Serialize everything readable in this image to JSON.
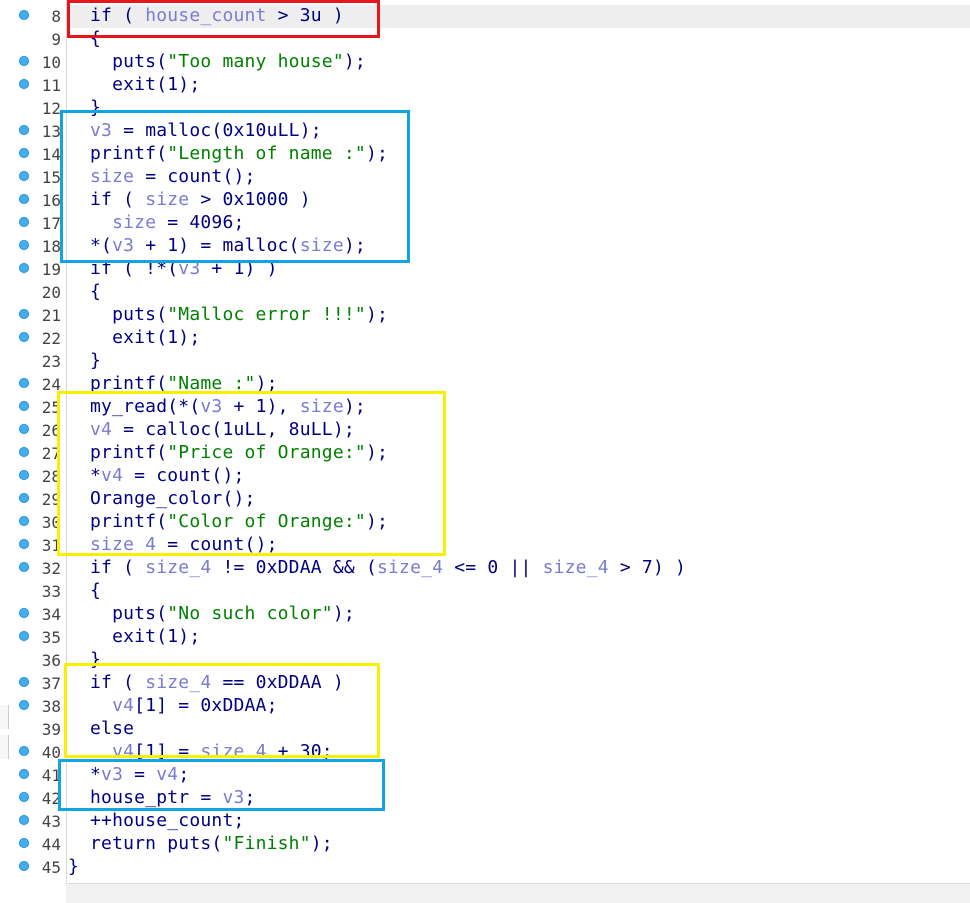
{
  "editor": {
    "lines": [
      {
        "n": "8",
        "dot": true,
        "hl": true,
        "t": [
          [
            "k",
            "if ( "
          ],
          [
            "v",
            "house_count"
          ],
          [
            "k",
            " > 3u )"
          ]
        ]
      },
      {
        "n": "9",
        "dot": false,
        "t": [
          [
            "k",
            "{"
          ]
        ]
      },
      {
        "n": "10",
        "dot": true,
        "t": [
          [
            "k",
            "  puts("
          ],
          [
            "s",
            "\"Too many house\""
          ],
          [
            "k",
            ");"
          ]
        ]
      },
      {
        "n": "11",
        "dot": true,
        "t": [
          [
            "k",
            "  exit(1);"
          ]
        ]
      },
      {
        "n": "12",
        "dot": false,
        "t": [
          [
            "k",
            "}"
          ]
        ]
      },
      {
        "n": "13",
        "dot": true,
        "t": [
          [
            "v",
            "v3"
          ],
          [
            "k",
            " = malloc(0x10uLL);"
          ]
        ]
      },
      {
        "n": "14",
        "dot": true,
        "t": [
          [
            "k",
            "printf("
          ],
          [
            "s",
            "\"Length of name :\""
          ],
          [
            "k",
            ");"
          ]
        ]
      },
      {
        "n": "15",
        "dot": true,
        "t": [
          [
            "v",
            "size"
          ],
          [
            "k",
            " = count();"
          ]
        ]
      },
      {
        "n": "16",
        "dot": true,
        "t": [
          [
            "k",
            "if ( "
          ],
          [
            "v",
            "size"
          ],
          [
            "k",
            " > 0x1000 )"
          ]
        ]
      },
      {
        "n": "17",
        "dot": true,
        "t": [
          [
            "k",
            "  "
          ],
          [
            "v",
            "size"
          ],
          [
            "k",
            " = 4096;"
          ]
        ]
      },
      {
        "n": "18",
        "dot": true,
        "t": [
          [
            "k",
            "*("
          ],
          [
            "v",
            "v3"
          ],
          [
            "k",
            " + 1) = malloc("
          ],
          [
            "v",
            "size"
          ],
          [
            "k",
            ");"
          ]
        ]
      },
      {
        "n": "19",
        "dot": true,
        "t": [
          [
            "k",
            "if ( !*("
          ],
          [
            "v",
            "v3"
          ],
          [
            "k",
            " + 1) )"
          ]
        ]
      },
      {
        "n": "20",
        "dot": false,
        "t": [
          [
            "k",
            "{"
          ]
        ]
      },
      {
        "n": "21",
        "dot": true,
        "t": [
          [
            "k",
            "  puts("
          ],
          [
            "s",
            "\"Malloc error !!!\""
          ],
          [
            "k",
            ");"
          ]
        ]
      },
      {
        "n": "22",
        "dot": true,
        "t": [
          [
            "k",
            "  exit(1);"
          ]
        ]
      },
      {
        "n": "23",
        "dot": false,
        "t": [
          [
            "k",
            "}"
          ]
        ]
      },
      {
        "n": "24",
        "dot": true,
        "t": [
          [
            "k",
            "printf("
          ],
          [
            "s",
            "\"Name :\""
          ],
          [
            "k",
            ");"
          ]
        ]
      },
      {
        "n": "25",
        "dot": true,
        "t": [
          [
            "k",
            "my_read(*("
          ],
          [
            "v",
            "v3"
          ],
          [
            "k",
            " + 1), "
          ],
          [
            "v",
            "size"
          ],
          [
            "k",
            ");"
          ]
        ]
      },
      {
        "n": "26",
        "dot": true,
        "t": [
          [
            "v",
            "v4"
          ],
          [
            "k",
            " = calloc(1uLL, 8uLL);"
          ]
        ]
      },
      {
        "n": "27",
        "dot": true,
        "t": [
          [
            "k",
            "printf("
          ],
          [
            "s",
            "\"Price of Orange:\""
          ],
          [
            "k",
            ");"
          ]
        ]
      },
      {
        "n": "28",
        "dot": true,
        "t": [
          [
            "k",
            "*"
          ],
          [
            "v",
            "v4"
          ],
          [
            "k",
            " = count();"
          ]
        ]
      },
      {
        "n": "29",
        "dot": true,
        "t": [
          [
            "k",
            "Orange_color();"
          ]
        ]
      },
      {
        "n": "30",
        "dot": true,
        "t": [
          [
            "k",
            "printf("
          ],
          [
            "s",
            "\"Color of Orange:\""
          ],
          [
            "k",
            ");"
          ]
        ]
      },
      {
        "n": "31",
        "dot": true,
        "t": [
          [
            "v",
            "size_4"
          ],
          [
            "k",
            " = count();"
          ]
        ]
      },
      {
        "n": "32",
        "dot": true,
        "t": [
          [
            "k",
            "if ( "
          ],
          [
            "v",
            "size_4"
          ],
          [
            "k",
            " != 0xDDAA && ("
          ],
          [
            "v",
            "size_4"
          ],
          [
            "k",
            " <= 0 || "
          ],
          [
            "v",
            "size_4"
          ],
          [
            "k",
            " > 7) )"
          ]
        ]
      },
      {
        "n": "33",
        "dot": false,
        "t": [
          [
            "k",
            "{"
          ]
        ]
      },
      {
        "n": "34",
        "dot": true,
        "t": [
          [
            "k",
            "  puts("
          ],
          [
            "s",
            "\"No such color\""
          ],
          [
            "k",
            ");"
          ]
        ]
      },
      {
        "n": "35",
        "dot": true,
        "t": [
          [
            "k",
            "  exit(1);"
          ]
        ]
      },
      {
        "n": "36",
        "dot": false,
        "t": [
          [
            "k",
            "}"
          ]
        ]
      },
      {
        "n": "37",
        "dot": true,
        "t": [
          [
            "k",
            "if ( "
          ],
          [
            "v",
            "size_4"
          ],
          [
            "k",
            " == 0xDDAA )"
          ]
        ]
      },
      {
        "n": "38",
        "dot": true,
        "t": [
          [
            "k",
            "  "
          ],
          [
            "v",
            "v4"
          ],
          [
            "k",
            "[1] = 0xDDAA;"
          ]
        ]
      },
      {
        "n": "39",
        "dot": false,
        "t": [
          [
            "k",
            "else"
          ]
        ]
      },
      {
        "n": "40",
        "dot": true,
        "t": [
          [
            "k",
            "  "
          ],
          [
            "v",
            "v4"
          ],
          [
            "k",
            "[1] = "
          ],
          [
            "v",
            "size_4"
          ],
          [
            "k",
            " + 30;"
          ]
        ]
      },
      {
        "n": "41",
        "dot": true,
        "t": [
          [
            "k",
            "*"
          ],
          [
            "v",
            "v3"
          ],
          [
            "k",
            " = "
          ],
          [
            "v",
            "v4"
          ],
          [
            "k",
            ";"
          ]
        ]
      },
      {
        "n": "42",
        "dot": true,
        "t": [
          [
            "k",
            "house_ptr = "
          ],
          [
            "v",
            "v3"
          ],
          [
            "k",
            ";"
          ]
        ]
      },
      {
        "n": "43",
        "dot": true,
        "t": [
          [
            "k",
            "++house_count;"
          ]
        ]
      },
      {
        "n": "44",
        "dot": true,
        "t": [
          [
            "k",
            "return puts("
          ],
          [
            "s",
            "\"Finish\""
          ],
          [
            "k",
            ");"
          ]
        ]
      },
      {
        "n": "45",
        "dot": true,
        "t": [
          [
            "k",
            "}"
          ]
        ]
      }
    ]
  },
  "colors": {
    "keyword": "#000080",
    "variable": "#7b7bd0",
    "string": "#008000",
    "breakpoint_dot": "#44aef0",
    "box_red": "#e8141c",
    "box_blue": "#12a3e3",
    "box_yellow": "#f9f000"
  }
}
